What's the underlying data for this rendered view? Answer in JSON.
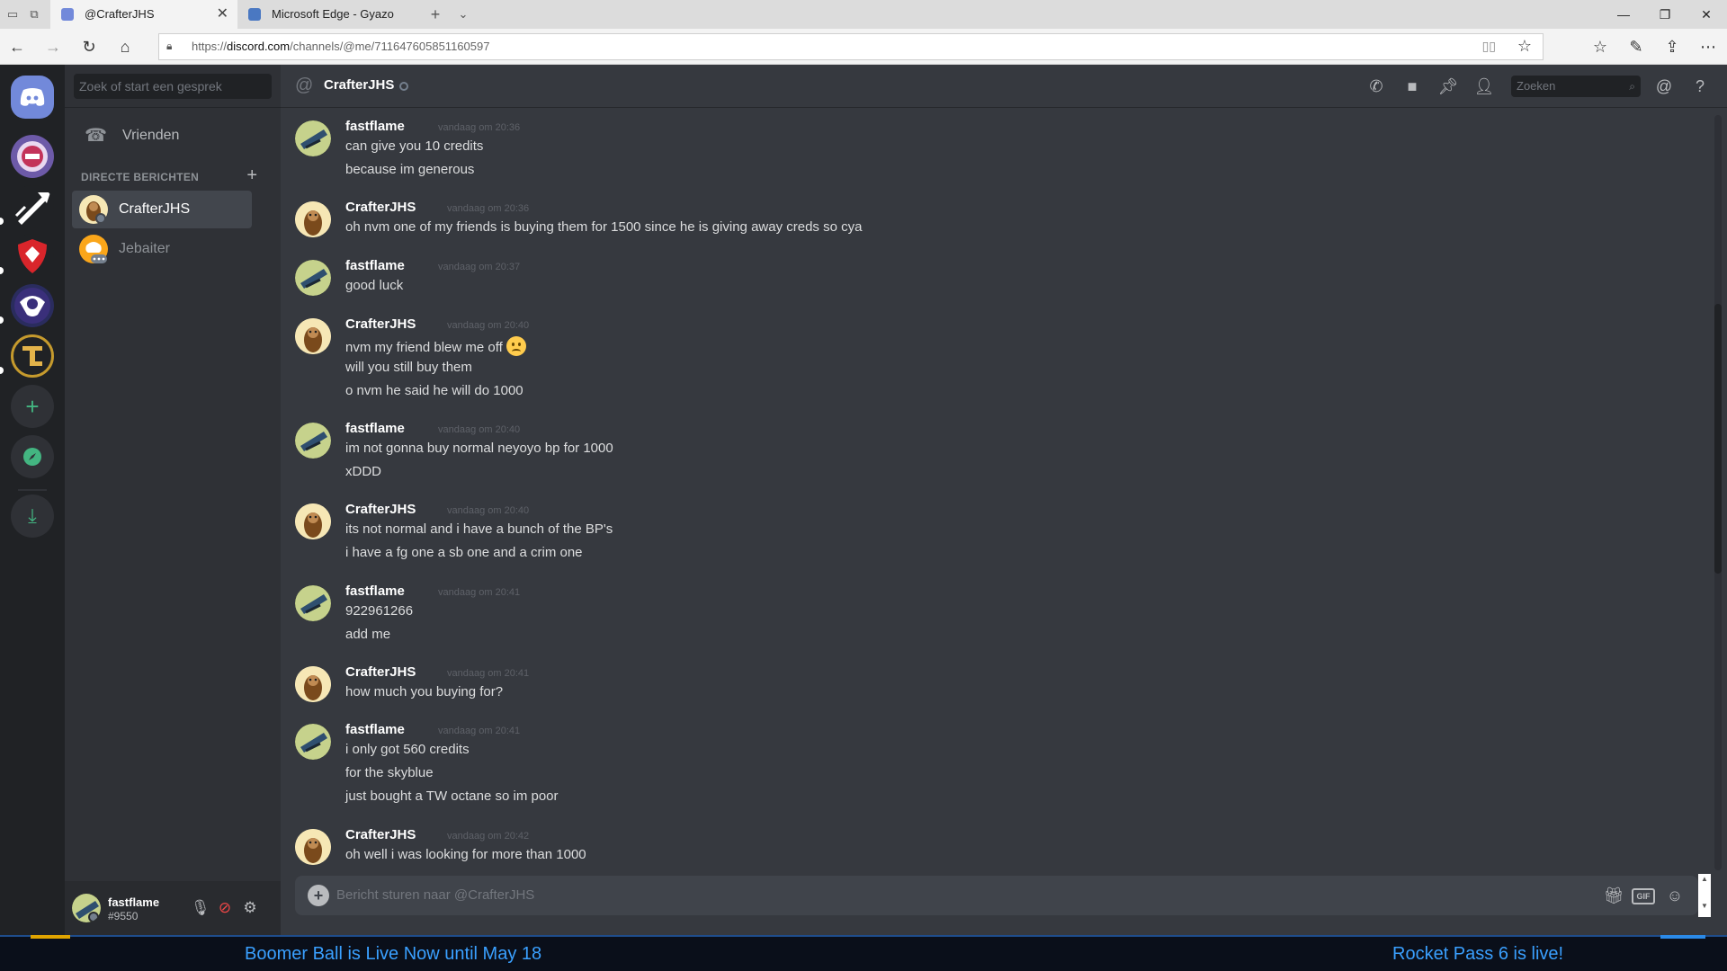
{
  "browser": {
    "tabs": [
      {
        "title": "@CrafterJHS",
        "active": true
      },
      {
        "title": "Microsoft Edge - Gyazo",
        "active": false
      }
    ],
    "url_prefix": "https://",
    "url_domain": "discord.com",
    "url_path": "/channels/@me/711647605851160597"
  },
  "sidebar": {
    "search_placeholder": "Zoek of start een gesprek",
    "friends_label": "Vrienden",
    "dm_header": "DIRECTE BERICHTEN",
    "dms": [
      {
        "name": "CrafterJHS",
        "active": true
      },
      {
        "name": "Jebaiter",
        "active": false
      }
    ]
  },
  "user": {
    "name": "fastflame",
    "tag": "#9550"
  },
  "channel": {
    "name": "CrafterJHS",
    "search_placeholder": "Zoeken"
  },
  "messages": [
    {
      "author": "fastflame",
      "time": "vandaag om 20:36",
      "lines": [
        "can give you 10 credits",
        "because im generous"
      ]
    },
    {
      "author": "CrafterJHS",
      "time": "vandaag om 20:36",
      "lines": [
        "oh nvm one of my friends is buying them for 1500 since he is giving away creds so cya"
      ]
    },
    {
      "author": "fastflame",
      "time": "vandaag om 20:37",
      "lines": [
        "good luck"
      ]
    },
    {
      "author": "CrafterJHS",
      "time": "vandaag om 20:40",
      "lines": [
        "nvm my friend blew me off",
        "will you still buy them",
        "o nvm he said he will do 1000"
      ]
    },
    {
      "author": "fastflame",
      "time": "vandaag om 20:40",
      "lines": [
        "im not gonna buy normal neyoyo bp for 1000",
        "xDDD"
      ]
    },
    {
      "author": "CrafterJHS",
      "time": "vandaag om 20:40",
      "lines": [
        "its not normal and i have a bunch of the BP's",
        "i have a fg one a sb one and a crim one"
      ]
    },
    {
      "author": "fastflame",
      "time": "vandaag om 20:41",
      "lines": [
        "922961266",
        "add me"
      ]
    },
    {
      "author": "CrafterJHS",
      "time": "vandaag om 20:41",
      "lines": [
        "how much you buying for?"
      ]
    },
    {
      "author": "fastflame",
      "time": "vandaag om 20:41",
      "lines": [
        "i only got 560 credits",
        "for the skyblue",
        "just bought a TW octane so im poor"
      ]
    },
    {
      "author": "CrafterJHS",
      "time": "vandaag om 20:42",
      "lines": [
        "oh well i was looking for more than 1000"
      ]
    }
  ],
  "composer": {
    "placeholder": "Bericht sturen naar @CrafterJHS",
    "gif_label": "GIF"
  },
  "ad": {
    "left": "Boomer Ball is Live Now until May 18",
    "right": "Rocket Pass 6 is live!"
  },
  "colors": {
    "discord_blurple": "#7289da",
    "bg_chat": "#36393f",
    "bg_sidebar": "#2f3136",
    "bg_guilds": "#202225",
    "ad_text": "#3aa0ff"
  }
}
